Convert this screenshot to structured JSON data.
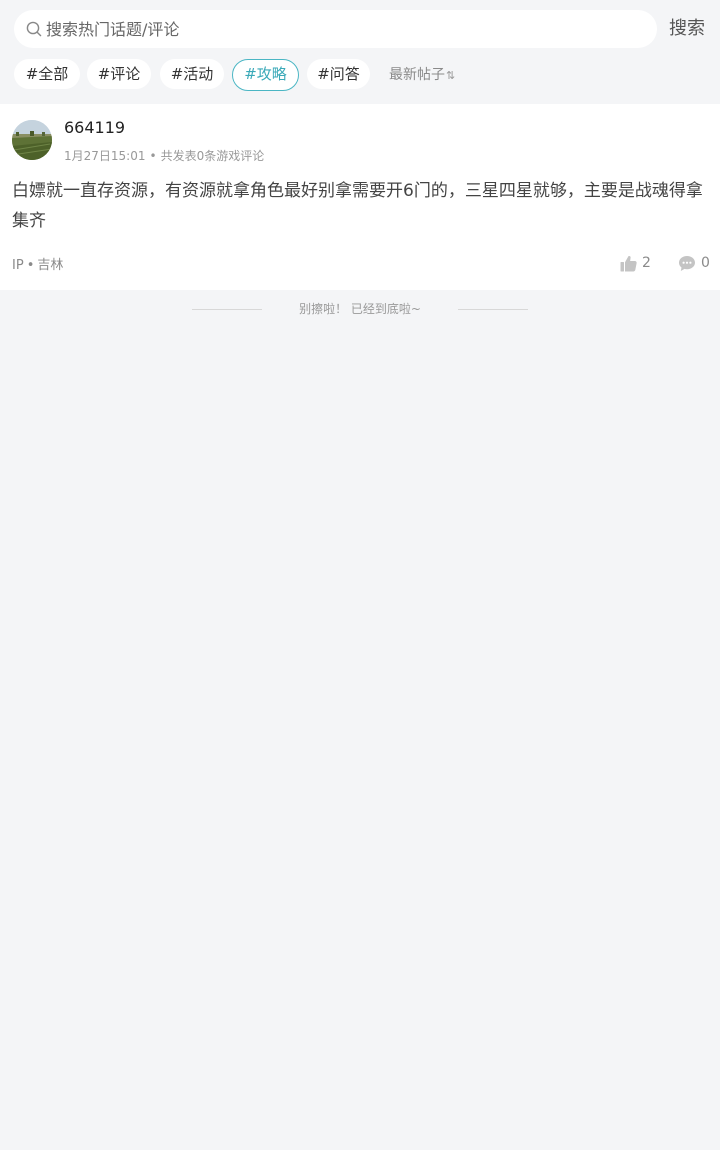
{
  "search": {
    "placeholder": "搜索热门话题/评论",
    "button_label": "搜索"
  },
  "filters": {
    "tags": [
      {
        "label": "#全部",
        "active": false
      },
      {
        "label": "#评论",
        "active": false
      },
      {
        "label": "#活动",
        "active": false
      },
      {
        "label": "#攻略",
        "active": true
      },
      {
        "label": "#问答",
        "active": false
      }
    ],
    "sort_label": "最新帖子",
    "sort_icon": "⇅",
    "active_color": "#3aa9b8"
  },
  "post": {
    "username": "664119",
    "date": "1月27日15:01",
    "separator": "•",
    "post_count_text": "共发表0条游戏评论",
    "content": "白嫖就一直存资源，有资源就拿角色最好别拿需要开6门的，三星四星就够，主要是战魂得拿集齐",
    "ip_label": "IP",
    "ip_location": "吉林",
    "likes": "2",
    "comments": "0"
  },
  "footer": {
    "end_text": "别擦啦！ 已经到底啦~"
  }
}
